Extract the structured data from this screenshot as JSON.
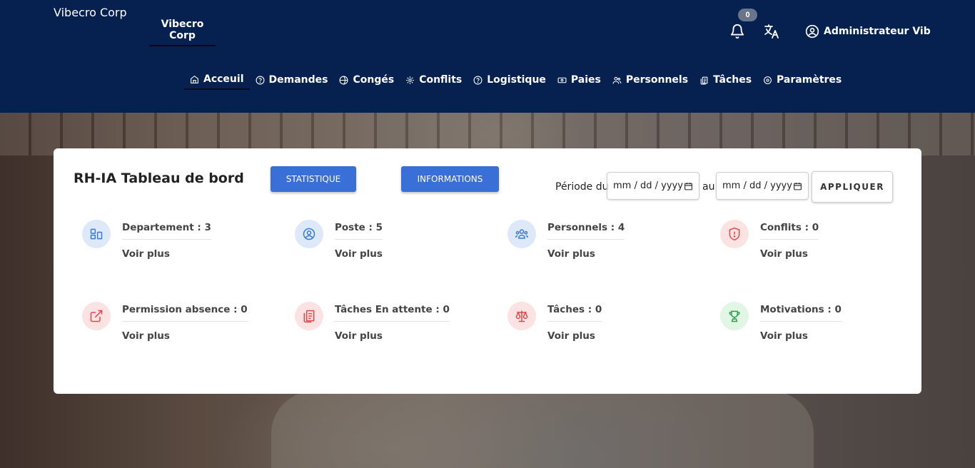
{
  "brand": "Vibecro Corp",
  "org_tab": "Vibecro Corp",
  "notifications": {
    "count": "0"
  },
  "user": {
    "name": "Administrateur Vib"
  },
  "nav": [
    {
      "label": "Acceuil",
      "icon": "home-icon"
    },
    {
      "label": "Demandes",
      "icon": "help-circle-icon"
    },
    {
      "label": "Congés",
      "icon": "globe-icon"
    },
    {
      "label": "Conflits",
      "icon": "settings-icon"
    },
    {
      "label": "Logistique",
      "icon": "help-circle-icon"
    },
    {
      "label": "Paies",
      "icon": "money-icon"
    },
    {
      "label": "Personnels",
      "icon": "users-icon"
    },
    {
      "label": "Tâches",
      "icon": "copy-icon"
    },
    {
      "label": "Paramètres",
      "icon": "gear-icon"
    }
  ],
  "dashboard": {
    "title": "RH-IA Tableau de bord",
    "btn_stat": "STATISTIQUE",
    "btn_info": "INFORMATIONS",
    "period_label": "Période du",
    "date_from_placeholder": "mm / dd / yyyy",
    "au_label": "au",
    "date_to_placeholder": "mm / dd / yyyy",
    "apply": "APPLIQUER",
    "stats": [
      {
        "label": "Departement : 3",
        "more": "Voir plus",
        "icon": "department-icon",
        "tone": "blue"
      },
      {
        "label": "Poste : 5",
        "more": "Voir plus",
        "icon": "user-circle-icon",
        "tone": "blue"
      },
      {
        "label": "Personnels : 4",
        "more": "Voir plus",
        "icon": "team-icon",
        "tone": "blue"
      },
      {
        "label": "Conflits : 0",
        "more": "Voir plus",
        "icon": "shield-alert-icon",
        "tone": "red"
      },
      {
        "label": "Permission absence : 0",
        "more": "Voir plus",
        "icon": "external-link-icon",
        "tone": "red"
      },
      {
        "label": "Tâches En attente : 0",
        "more": "Voir plus",
        "icon": "clipboard-icon",
        "tone": "red"
      },
      {
        "label": "Tâches : 0",
        "more": "Voir plus",
        "icon": "scale-icon",
        "tone": "red"
      },
      {
        "label": "Motivations : 0",
        "more": "Voir plus",
        "icon": "trophy-icon",
        "tone": "green"
      }
    ]
  },
  "colors": {
    "header": "#062150",
    "primary_button": "#3a6fd8",
    "icon_blue": "#3a7bd5",
    "icon_red": "#e04848",
    "icon_green": "#2e9e4f"
  }
}
